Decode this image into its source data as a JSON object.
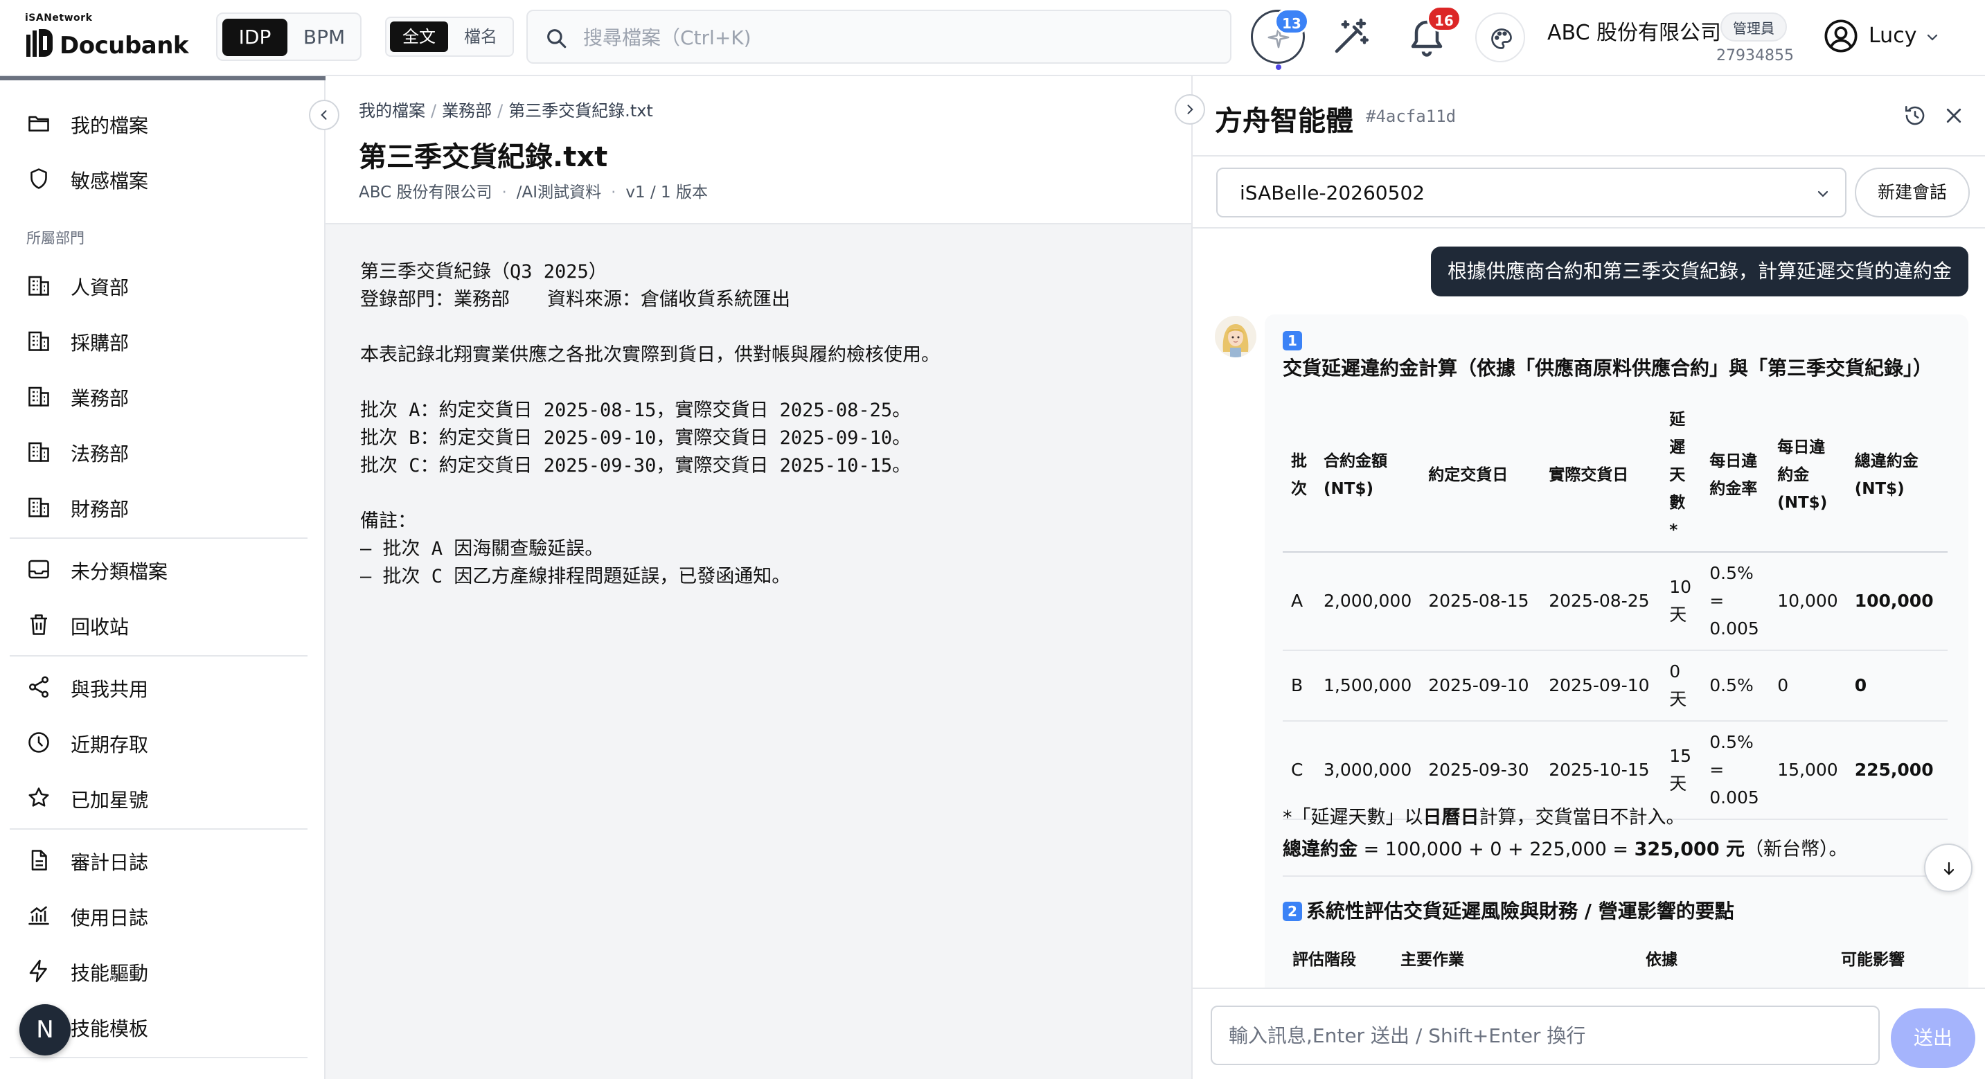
{
  "app": {
    "logo_sub": "iSANetwork",
    "logo_name": "Docubank"
  },
  "topbar": {
    "modes": [
      "IDP",
      "BPM"
    ],
    "scopes": [
      "全文",
      "檔名"
    ],
    "search_placeholder": "搜尋檔案（Ctrl+K)",
    "ai_badge": "13",
    "notif_badge": "16",
    "org_name": "ABC 股份有限公司",
    "org_role": "管理員",
    "org_taxid": "27934855",
    "user_name": "Lucy"
  },
  "sidebar": {
    "items_top": [
      {
        "label": "我的檔案",
        "icon": "folder-icon"
      },
      {
        "label": "敏感檔案",
        "icon": "shield-icon"
      }
    ],
    "dept_section_label": "所屬部門",
    "departments": [
      {
        "label": "人資部",
        "icon": "building-icon"
      },
      {
        "label": "採購部",
        "icon": "building-icon"
      },
      {
        "label": "業務部",
        "icon": "building-icon"
      },
      {
        "label": "法務部",
        "icon": "building-icon"
      },
      {
        "label": "財務部",
        "icon": "building-icon"
      }
    ],
    "items_misc": [
      {
        "label": "未分類檔案",
        "icon": "inbox-icon"
      },
      {
        "label": "回收站",
        "icon": "trash-icon"
      }
    ],
    "items_access": [
      {
        "label": "與我共用",
        "icon": "share-icon"
      },
      {
        "label": "近期存取",
        "icon": "clock-icon"
      },
      {
        "label": "已加星號",
        "icon": "star-icon"
      }
    ],
    "items_logs": [
      {
        "label": "審計日誌",
        "icon": "file-text-icon"
      },
      {
        "label": "使用日誌",
        "icon": "chart-icon"
      },
      {
        "label": "技能驅動",
        "icon": "bolt-icon"
      },
      {
        "label": "技能模板",
        "icon": "template-icon"
      }
    ],
    "user_initial": "N"
  },
  "document": {
    "breadcrumb": [
      "我的檔案",
      "業務部",
      "第三季交貨紀錄.txt"
    ],
    "title": "第三季交貨紀錄.txt",
    "meta_org": "ABC 股份有限公司",
    "meta_path": "/AI測試資料",
    "meta_version": "v1 / 1 版本",
    "lines": [
      "第三季交貨紀錄（Q3 2025）",
      "登錄部門：業務部　　資料來源：倉儲收貨系統匯出",
      "",
      "本表記錄北翔實業供應之各批次實際到貨日，供對帳與履約檢核使用。",
      "",
      "批次 A：約定交貨日 2025-08-15，實際交貨日 2025-08-25。",
      "批次 B：約定交貨日 2025-09-10，實際交貨日 2025-09-10。",
      "批次 C：約定交貨日 2025-09-30，實際交貨日 2025-10-15。",
      "",
      "備註：",
      "— 批次 A 因海關查驗延誤。",
      "— 批次 C 因乙方產線排程問題延誤，已發函通知。"
    ]
  },
  "panel": {
    "title": "方舟智能體",
    "agent_id": "#4acfa11d",
    "session_name": "iSABelle-20260502",
    "new_session_label": "新建會話",
    "user_message": "根據供應商合約和第三季交貨紀錄，計算延遲交貨的違約金",
    "section1_num": "1",
    "section1_title": "交貨延遲違約金計算（依據「供應商原料供應合約」與「第三季交貨紀錄」）",
    "table_headers": [
      "批次",
      "合約金額 (NT$)",
      "約定交貨日",
      "實際交貨日",
      "延遲天數*",
      "每日違約金率",
      "每日違約金 (NT$)",
      "總違約金 (NT$)"
    ],
    "table_rows": [
      [
        "A",
        "2,000,000",
        "2025-08-15",
        "2025-08-25",
        "10 天",
        "0.5% = 0.005",
        "10,000",
        "100,000"
      ],
      [
        "B",
        "1,500,000",
        "2025-09-10",
        "2025-09-10",
        "0 天",
        "0.5%",
        "0",
        "0"
      ],
      [
        "C",
        "3,000,000",
        "2025-09-30",
        "2025-10-15",
        "15 天",
        "0.5% = 0.005",
        "15,000",
        "225,000"
      ]
    ],
    "footnote_prefix": "*「延遲天數」以",
    "footnote_bold": "日曆日",
    "footnote_suffix": "計算，交貨當日不計入。",
    "total_label": "總違約金",
    "total_expr": " = 100,000 + 0 + 225,000 = ",
    "total_value": "325,000",
    "total_unit": " 元",
    "total_note": "（新台幣）。",
    "section2_num": "2",
    "section2_title": "系統性評估交貨延遲風險與財務 / 營運影響的要點",
    "risk_headers": [
      "評估階段",
      "主要作業",
      "依據",
      "可能影響"
    ],
    "composer_placeholder": "輸入訊息,Enter 送出 / Shift+Enter 換行",
    "send_label": "送出"
  }
}
